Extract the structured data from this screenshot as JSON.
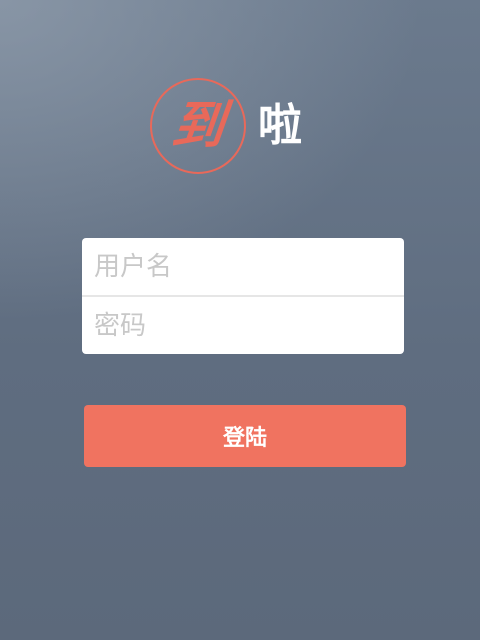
{
  "logo": {
    "seal_char": "到",
    "text": "啦"
  },
  "form": {
    "username_placeholder": "用户名",
    "password_placeholder": "密码"
  },
  "login_button": {
    "label": "登陆"
  },
  "colors": {
    "accent": "#f07360",
    "seal": "#e8695a",
    "background": "#5f6d80"
  }
}
